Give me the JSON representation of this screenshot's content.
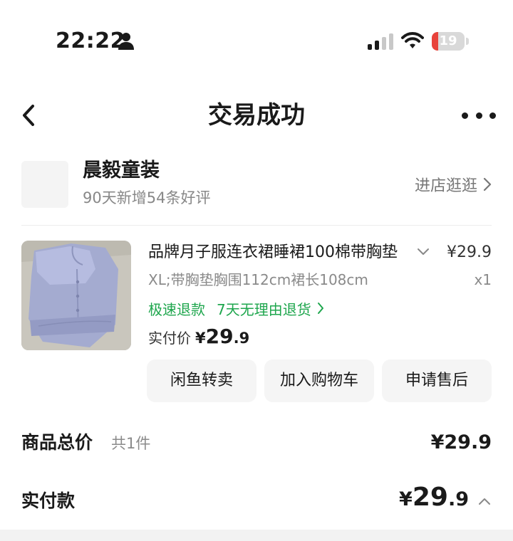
{
  "status_bar": {
    "time": "22:22",
    "battery": "19",
    "battery_level": 0.19
  },
  "nav": {
    "title": "交易成功"
  },
  "shop": {
    "name": "晨毅童装",
    "subtitle": "90天新增54条好评",
    "visit_label": "进店逛逛"
  },
  "product": {
    "title": "品牌月子服连衣裙睡裙100棉带胸垫",
    "price": "¥29.9",
    "sku": "XL;带胸垫胸围112cm裙长108cm",
    "quantity": "x1",
    "service_fast_refund": "极速退款",
    "service_return": "7天无理由退货",
    "paid_label": "实付价",
    "paid_currency": "¥",
    "paid_int": "29",
    "paid_dec": ".9",
    "actions": [
      "闲鱼转卖",
      "加入购物车",
      "申请售后"
    ]
  },
  "summary": {
    "total_label": "商品总价",
    "total_count": "共1件",
    "total_value": "¥29.9",
    "paid_label": "实付款",
    "paid_currency": "¥",
    "paid_int": "29",
    "paid_dec": ".9"
  },
  "colors": {
    "accent_green": "#1ea64d",
    "battery_low": "#e8433b",
    "text_primary": "#1a1a1a",
    "text_secondary": "#8a8a8a"
  },
  "icons": {
    "person": "person-icon",
    "signal": "signal-icon",
    "wifi": "wifi-icon",
    "back": "back-arrow-icon",
    "more": "more-dots-icon",
    "chevron_right": "chevron-right-icon",
    "chevron_down": "chevron-down-icon",
    "chevron_up": "chevron-up-icon"
  }
}
